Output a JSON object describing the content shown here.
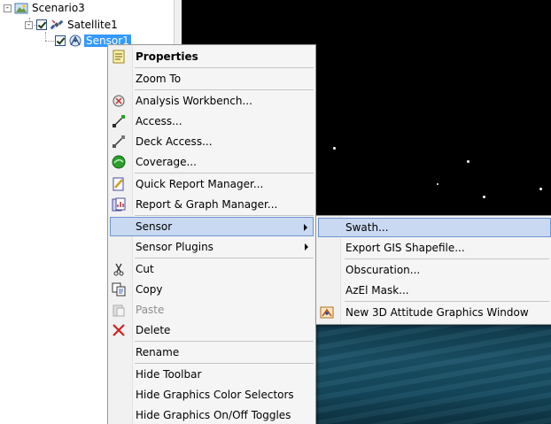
{
  "tree": {
    "items": [
      {
        "label": "Scenario3",
        "icon": "scenario-icon"
      },
      {
        "label": "Satellite1",
        "icon": "satellite-icon"
      },
      {
        "label": "Sensor1",
        "icon": "sensor-icon",
        "selected": true
      }
    ],
    "expanders": [
      "-",
      "-"
    ]
  },
  "context_menu": {
    "items": [
      {
        "label": "Properties",
        "icon": "properties-icon",
        "bold": true
      },
      {
        "label": "Zoom To"
      },
      {
        "label": "Analysis Workbench...",
        "icon": "analysis-workbench-icon"
      },
      {
        "label": "Access...",
        "icon": "access-icon"
      },
      {
        "label": "Deck Access...",
        "icon": "deck-access-icon"
      },
      {
        "label": "Coverage...",
        "icon": "coverage-icon"
      },
      {
        "label": "Quick Report Manager...",
        "icon": "quick-report-icon"
      },
      {
        "label": "Report & Graph Manager...",
        "icon": "report-graph-icon"
      },
      {
        "label": "Sensor",
        "submenu": true,
        "highlighted": true
      },
      {
        "label": "Sensor Plugins",
        "submenu": true
      },
      {
        "label": "Cut",
        "icon": "cut-icon"
      },
      {
        "label": "Copy",
        "icon": "copy-icon"
      },
      {
        "label": "Paste",
        "icon": "paste-icon",
        "disabled": true
      },
      {
        "label": "Delete",
        "icon": "delete-icon"
      },
      {
        "label": "Rename"
      },
      {
        "label": "Hide Toolbar"
      },
      {
        "label": "Hide Graphics Color Selectors"
      },
      {
        "label": "Hide Graphics On/Off Toggles"
      }
    ]
  },
  "sensor_submenu": {
    "items": [
      {
        "label": "Swath...",
        "highlighted": true
      },
      {
        "label": "Export GIS Shapefile..."
      },
      {
        "label": "Obscuration..."
      },
      {
        "label": "AzEl Mask..."
      },
      {
        "label": "New 3D Attitude Graphics Window",
        "icon": "attitude-graphics-icon"
      }
    ]
  },
  "colors": {
    "highlight": "#c9d9f1",
    "highlight_border": "#6e95d1",
    "tree_selection": "#3399ff",
    "space": "#000000",
    "ocean": "#1b5268"
  }
}
